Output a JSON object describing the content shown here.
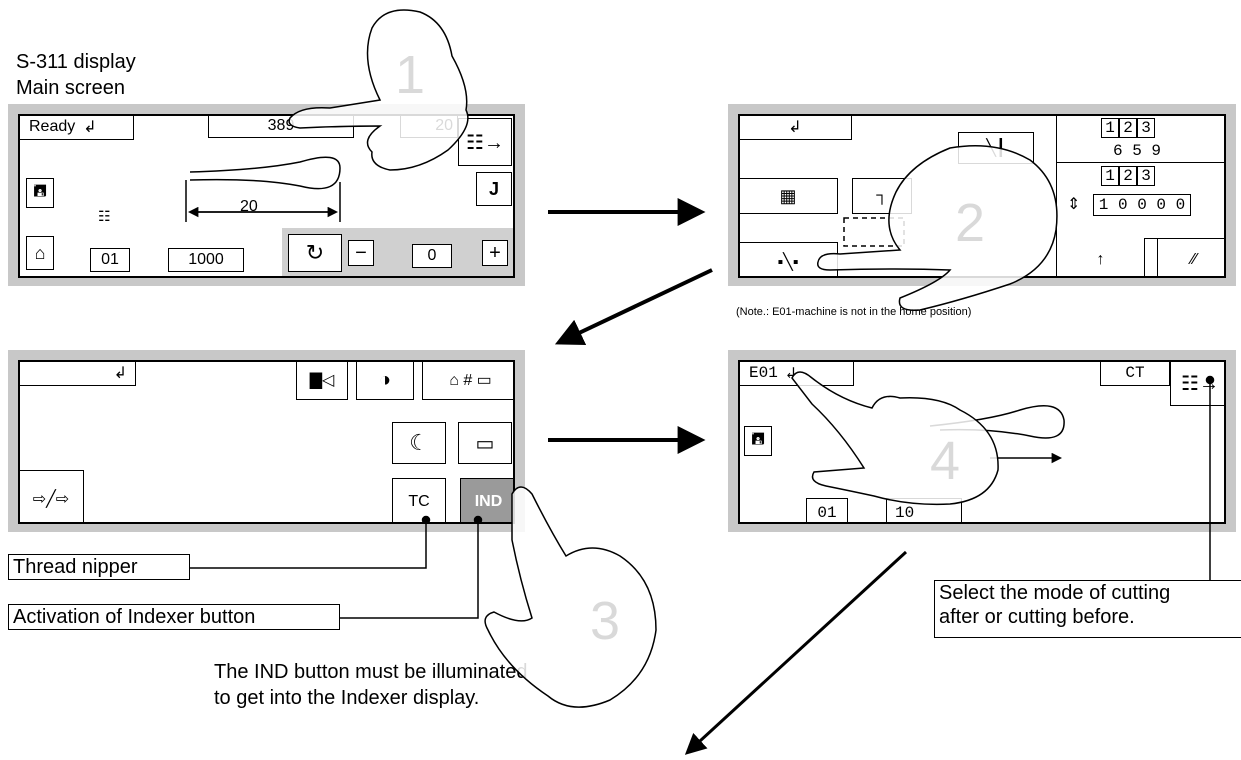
{
  "title": {
    "line1": "S-311 display",
    "line2": "Main screen"
  },
  "note": "(Note.: E01-machine is not in the home position)",
  "screen1": {
    "status": "Ready",
    "stitch_count": "389",
    "counter_right": "20",
    "dimension": "20",
    "program_no": "01",
    "speed": "1000",
    "value": "0"
  },
  "screen2": {
    "digits_top": [
      "1",
      "2",
      "3"
    ],
    "number_top": "6 5 9",
    "digits_mid": [
      "1",
      "2",
      "3"
    ],
    "counter": "1 0 0 0 0"
  },
  "screen3": {
    "tc_label": "TC",
    "ind_label": "IND"
  },
  "screen4": {
    "error": "E01",
    "ct_label": "CT",
    "program_no": "01",
    "speed_partial": "10"
  },
  "callouts": {
    "thread_nipper": "Thread nipper",
    "indexer_button": "Activation of Indexer button",
    "cut_mode_line1": "Select the mode of cutting",
    "cut_mode_line2": "after or cutting before."
  },
  "instruction": {
    "line1": "The IND button must be illuminated",
    "line2": "to get into the Indexer display."
  },
  "steps": [
    "1",
    "2",
    "3",
    "4"
  ]
}
